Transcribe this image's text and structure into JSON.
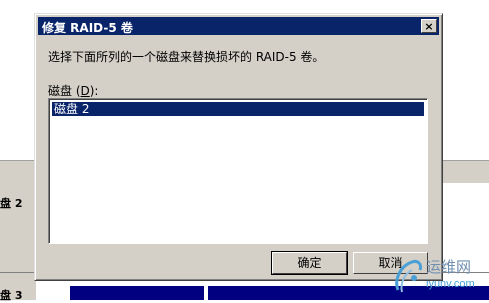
{
  "background": {
    "disk2_label": "盘 2",
    "disk3_label": "盘 3"
  },
  "dialog": {
    "title": "修复 RAID-5 卷",
    "close_glyph": "×",
    "instruction": "选择下面所列的一个磁盘来替换损坏的 RAID-5 卷。",
    "disk_label_prefix": "磁盘 (",
    "disk_label_hotkey": "D",
    "disk_label_suffix": "):",
    "disks": [
      "磁盘 2"
    ],
    "ok_label": "确定",
    "cancel_label": "取消"
  },
  "watermark": {
    "line1": "运维网",
    "line2": "iyunv.com"
  },
  "colors": {
    "titlebar": "#0a246a",
    "dialog_face": "#d4d0c8",
    "selection": "#0a246a"
  }
}
